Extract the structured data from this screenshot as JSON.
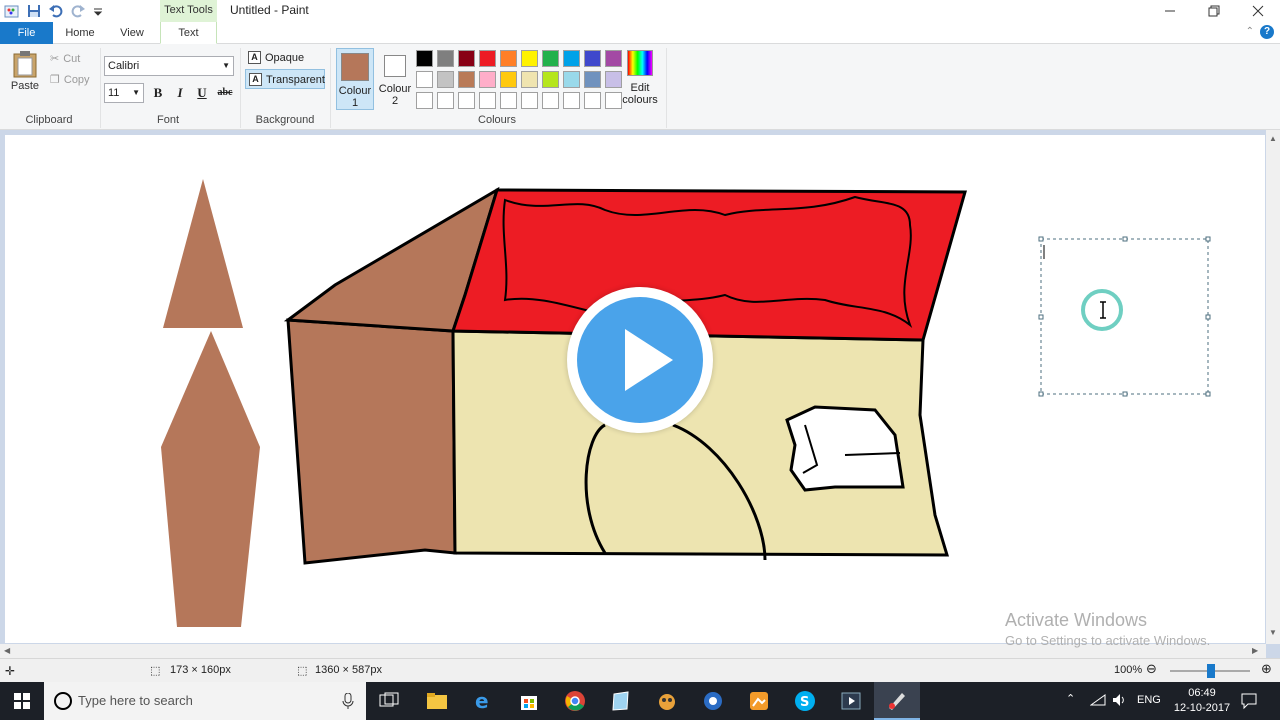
{
  "window": {
    "title": "Untitled - Paint",
    "context_tab": "Text Tools"
  },
  "tabs": [
    "File",
    "Home",
    "View",
    "Text"
  ],
  "ribbon": {
    "clipboard": {
      "paste": "Paste",
      "cut": "Cut",
      "copy": "Copy",
      "label": "Clipboard"
    },
    "font": {
      "family": "Calibri",
      "size": "11",
      "bold": "B",
      "italic": "I",
      "underline": "U",
      "strike": "abc",
      "label": "Font"
    },
    "background": {
      "opaque": "Opaque",
      "transparent": "Transparent",
      "label": "Background"
    },
    "colours": {
      "colour1_line1": "Colour",
      "colour1_line2": "1",
      "colour2_line1": "Colour",
      "colour2_line2": "2",
      "edit_line1": "Edit",
      "edit_line2": "colours",
      "label": "Colours",
      "colour1": "#b5775a",
      "colour2": "#ffffff",
      "palette": [
        "#000000",
        "#7f7f7f",
        "#880015",
        "#ed1c24",
        "#ff7f27",
        "#fff200",
        "#22b14c",
        "#00a2e8",
        "#3f48cc",
        "#a349a4",
        "#ffffff",
        "#c3c3c3",
        "#b97a57",
        "#ffaec9",
        "#ffc90e",
        "#efe4b0",
        "#b5e61d",
        "#99d9ea",
        "#7092be",
        "#c8bfe7",
        "#ffffff",
        "#ffffff",
        "#ffffff",
        "#ffffff",
        "#ffffff",
        "#ffffff",
        "#ffffff",
        "#ffffff",
        "#ffffff",
        "#ffffff"
      ]
    }
  },
  "canvas": {
    "watermark_line1": "Activate Windows",
    "watermark_line2": "Go to Settings to activate Windows."
  },
  "status": {
    "selection_size": "173 × 160px",
    "image_size": "1360 × 587px",
    "zoom": "100%"
  },
  "taskbar": {
    "search_placeholder": "Type here to search",
    "language": "ENG",
    "time": "06:49",
    "date": "12-10-2017"
  }
}
